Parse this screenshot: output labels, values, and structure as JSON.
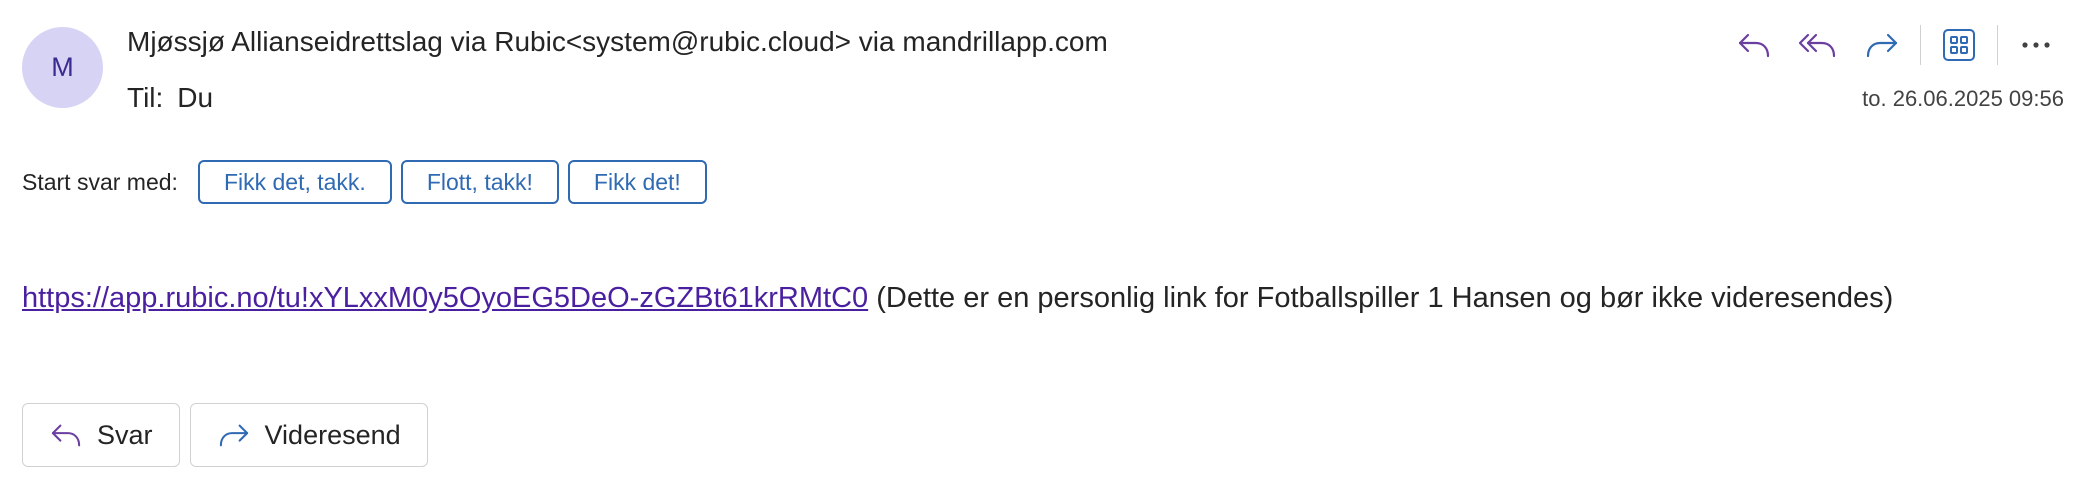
{
  "sender": {
    "avatar_initial": "M",
    "line": "Mjøssjø Allianseidrettslag via Rubic<system@rubic.cloud> via mandrillapp.com"
  },
  "recipient": {
    "label": "Til:",
    "name": "Du"
  },
  "date": "to. 26.06.2025 09:56",
  "toolbar": {
    "icons": [
      "reply-icon",
      "reply-all-icon",
      "forward-icon",
      "apps-icon",
      "more-icon"
    ]
  },
  "quick_replies": {
    "label": "Start svar med:",
    "options": [
      "Fikk det, takk.",
      "Flott, takk!",
      "Fikk det!"
    ]
  },
  "body": {
    "link": "https://app.rubic.no/tu!xYLxxM0y5OyoEG5DeO-zGZBt61krRMtC0",
    "note": " (Dette er en personlig link for Fotballspiller 1 Hansen og bør ikke videresendes)"
  },
  "actions": {
    "reply_label": "Svar",
    "forward_label": "Videresend"
  },
  "colors": {
    "accent": "#2f6ab3",
    "icon_purple": "#6b3fa0",
    "avatar_bg": "#d6d3f5",
    "link": "#4a1fa0"
  }
}
